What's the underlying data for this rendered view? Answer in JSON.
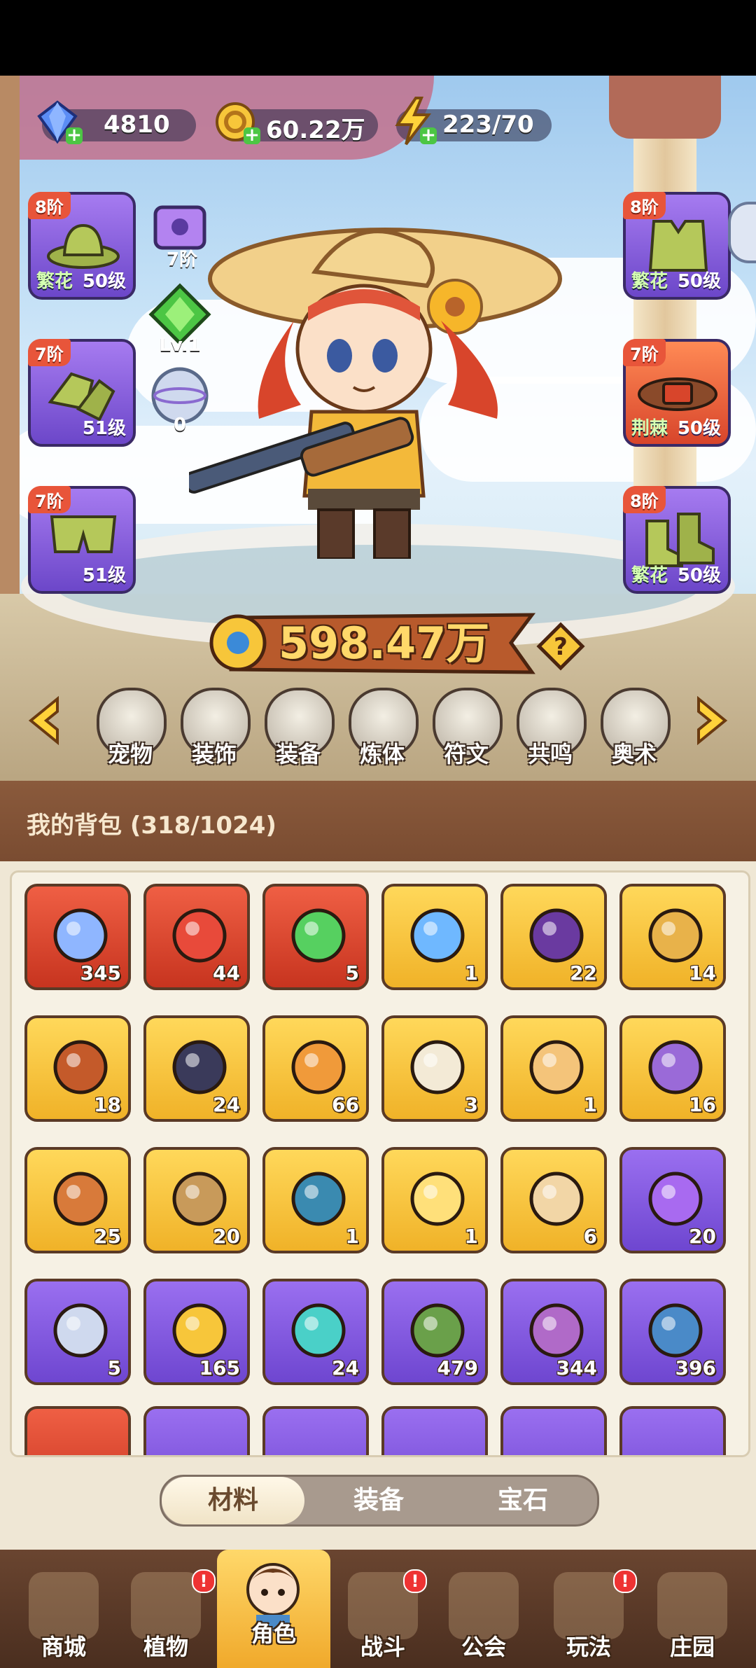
{
  "currencies": {
    "gems": "4810",
    "gold": "60.22万",
    "energy": "223/70"
  },
  "equipment_left": [
    {
      "tier": "8阶",
      "level": "50级",
      "tag": "繁花",
      "color": "purple"
    },
    {
      "tier": "7阶",
      "level": "51级",
      "tag": "",
      "color": "purple"
    },
    {
      "tier": "7阶",
      "level": "51级",
      "tag": "",
      "color": "purple"
    }
  ],
  "equipment_right": [
    {
      "tier": "8阶",
      "level": "50级",
      "tag": "繁花",
      "color": "purple"
    },
    {
      "tier": "7阶",
      "level": "50级",
      "tag": "荆棘",
      "color": "red"
    },
    {
      "tier": "8阶",
      "level": "50级",
      "tag": "繁花",
      "color": "purple"
    }
  ],
  "side_items": {
    "pet_tier": "7阶",
    "gem_level": "Lv.1",
    "orb_count": "0"
  },
  "power": "598.47万",
  "menu": [
    "宠物",
    "装饰",
    "装备",
    "炼体",
    "符文",
    "共鸣",
    "奥术"
  ],
  "backpack": {
    "title": "我的背包 (318/1024)",
    "items": [
      {
        "icon": "star-crystal-icon",
        "count": "345",
        "rarity": "red"
      },
      {
        "icon": "red-potion-icon",
        "count": "44",
        "rarity": "red"
      },
      {
        "icon": "green-vial-icon",
        "count": "5",
        "rarity": "red"
      },
      {
        "icon": "water-drop-icon",
        "count": "1",
        "rarity": "gold"
      },
      {
        "icon": "skull-scroll-icon",
        "count": "22",
        "rarity": "gold"
      },
      {
        "icon": "gold-key-icon",
        "count": "14",
        "rarity": "gold"
      },
      {
        "icon": "pyramid-icon",
        "count": "18",
        "rarity": "gold"
      },
      {
        "icon": "rune-stone-icon",
        "count": "24",
        "rarity": "gold"
      },
      {
        "icon": "orange-potion-icon",
        "count": "66",
        "rarity": "gold"
      },
      {
        "icon": "bone-icon",
        "count": "3",
        "rarity": "gold"
      },
      {
        "icon": "cake-icon",
        "count": "1",
        "rarity": "gold"
      },
      {
        "icon": "spellbook-icon",
        "count": "16",
        "rarity": "gold"
      },
      {
        "icon": "jar-icon",
        "count": "25",
        "rarity": "gold"
      },
      {
        "icon": "chick-icon",
        "count": "20",
        "rarity": "gold"
      },
      {
        "icon": "blueprint-icon",
        "count": "1",
        "rarity": "gold"
      },
      {
        "icon": "flower-orb-icon",
        "count": "1",
        "rarity": "gold"
      },
      {
        "icon": "knot-icon",
        "count": "6",
        "rarity": "gold"
      },
      {
        "icon": "purple-potion-icon",
        "count": "20",
        "rarity": "purple"
      },
      {
        "icon": "silver-key-icon",
        "count": "5",
        "rarity": "purple"
      },
      {
        "icon": "arrow-badge-icon",
        "count": "165",
        "rarity": "purple"
      },
      {
        "icon": "leaf-icon",
        "count": "24",
        "rarity": "purple"
      },
      {
        "icon": "scroll-green-icon",
        "count": "479",
        "rarity": "purple"
      },
      {
        "icon": "scroll-pink-icon",
        "count": "344",
        "rarity": "purple"
      },
      {
        "icon": "scroll-blue-icon",
        "count": "396",
        "rarity": "purple"
      }
    ]
  },
  "tabs": [
    "材料",
    "装备",
    "宝石"
  ],
  "active_tab": "材料",
  "nav": [
    "商城",
    "植物",
    "角色",
    "战斗",
    "公会",
    "玩法",
    "庄园"
  ],
  "nav_badges": {
    "植物": "!",
    "战斗": "!",
    "玩法": "!"
  },
  "colors": {
    "accent": "#f0b228",
    "bag_header": "#8a5a3c",
    "nav_bg": "#4a2e1f"
  }
}
